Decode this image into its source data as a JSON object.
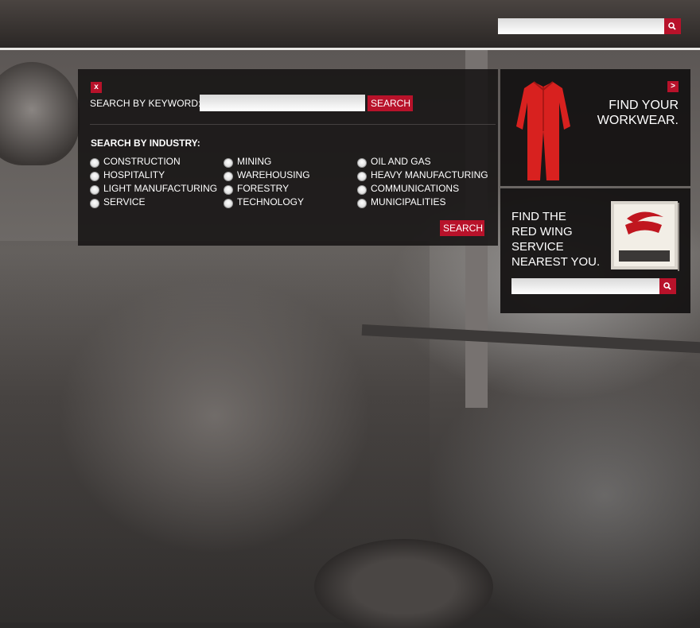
{
  "header": {
    "search": {
      "placeholder": "",
      "value": ""
    }
  },
  "panel": {
    "close_label": "x",
    "keyword_label": "SEARCH BY KEYWORD:",
    "keyword_value": "",
    "keyword_button": "SEARCH",
    "industry_label": "SEARCH BY INDUSTRY:",
    "industries": [
      [
        "CONSTRUCTION",
        "MINING",
        "OIL AND GAS"
      ],
      [
        "HOSPITALITY",
        "WAREHOUSING",
        "HEAVY MANUFACTURING"
      ],
      [
        "LIGHT MANUFACTURING",
        "FORESTRY",
        "COMMUNICATIONS"
      ],
      [
        "SERVICE",
        "TECHNOLOGY",
        "MUNICIPALITIES"
      ]
    ],
    "industry_button": "SEARCH"
  },
  "workwear_promo": {
    "arrow_label": ">",
    "title_line1": "FIND YOUR",
    "title_line2": "WORKWEAR."
  },
  "store_promo": {
    "title_line1": "FIND THE",
    "title_line2": "RED WING",
    "title_line3": "SERVICE",
    "title_line4": "NEAREST YOU.",
    "search_value": ""
  },
  "colors": {
    "accent": "#b8122a",
    "panel_bg": "#141212",
    "topbar": "#3a3533"
  },
  "icons": {
    "search": "search-icon",
    "close": "close-icon",
    "arrow": "chevron-right-icon"
  }
}
